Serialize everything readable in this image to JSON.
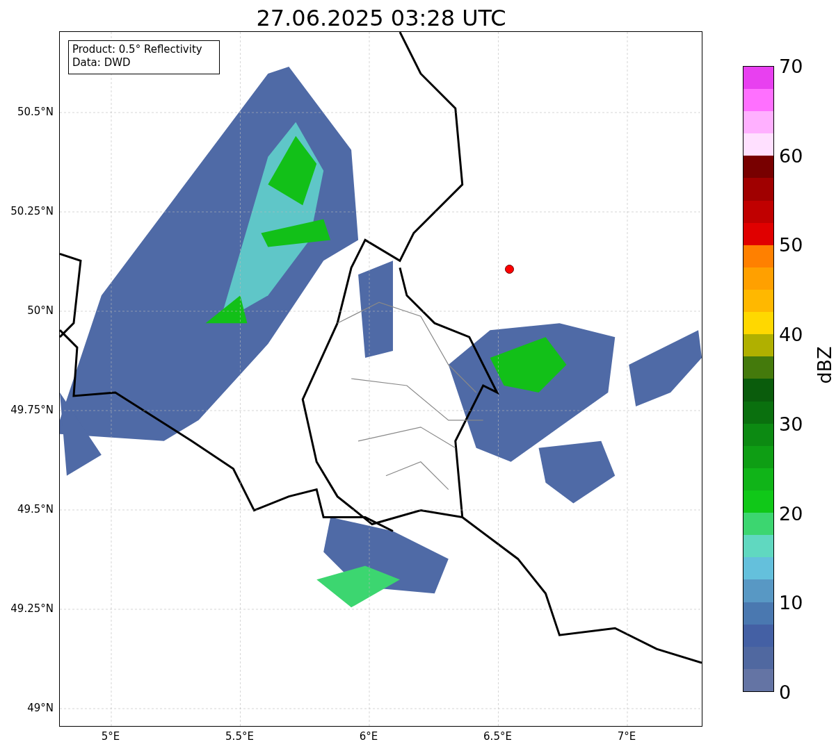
{
  "title": "27.06.2025 03:28 UTC",
  "map": {
    "legend_lines": [
      "Product: 0.5° Reflectivity",
      "Data: DWD"
    ],
    "y_ticks": [
      "50.5°N",
      "50.25°N",
      "50°N",
      "49.75°N",
      "49.5°N",
      "49.25°N",
      "49°N"
    ],
    "x_ticks": [
      "5°E",
      "5.5°E",
      "6°E",
      "6.5°E",
      "7°E"
    ]
  },
  "colorbar": {
    "label": "dBZ",
    "ticks": [
      "70",
      "60",
      "50",
      "40",
      "30",
      "20",
      "10",
      "0"
    ],
    "segments": [
      {
        "color": "#6474a4"
      },
      {
        "color": "#5068a0"
      },
      {
        "color": "#4460a4"
      },
      {
        "color": "#4a78b0"
      },
      {
        "color": "#5898c4"
      },
      {
        "color": "#64c0dc"
      },
      {
        "color": "#60d8c0"
      },
      {
        "color": "#3cd670"
      },
      {
        "color": "#10c818"
      },
      {
        "color": "#10b418"
      },
      {
        "color": "#0e9e14"
      },
      {
        "color": "#0c8a12"
      },
      {
        "color": "#0a700e"
      },
      {
        "color": "#0a5c0c"
      },
      {
        "color": "#447a0c"
      },
      {
        "color": "#b0b000"
      },
      {
        "color": "#ffd800"
      },
      {
        "color": "#ffb800"
      },
      {
        "color": "#ffa000"
      },
      {
        "color": "#ff8000"
      },
      {
        "color": "#e00000"
      },
      {
        "color": "#c00000"
      },
      {
        "color": "#a00000"
      },
      {
        "color": "#780000"
      },
      {
        "color": "#ffe0ff"
      },
      {
        "color": "#ffb0ff"
      },
      {
        "color": "#ff70ff"
      },
      {
        "color": "#e840f0"
      }
    ]
  }
}
